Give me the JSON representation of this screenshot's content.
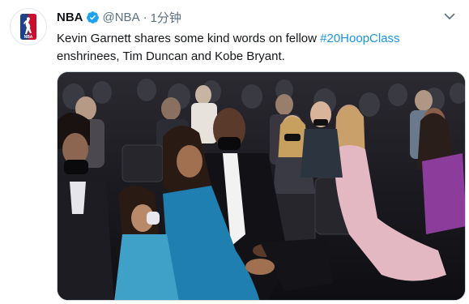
{
  "tweet": {
    "display_name": "NBA",
    "handle": "@NBA",
    "separator": "·",
    "time": "1分钟",
    "text_part1": "Kevin Garnett shares some kind words on fellow ",
    "hashtag": "#20HoopClass",
    "text_part2": " enshrinees, Tim Duncan and Kobe Bryant.",
    "media_description": "Video still of an audience seated in an arena, including Kevin Garnett and family"
  },
  "icons": {
    "avatar": "nba-logo-icon",
    "verified": "verified-badge-icon",
    "more": "chevron-down-icon"
  },
  "colors": {
    "hashtag": "#1b95e0",
    "verified": "#1da1f2",
    "text": "#14171a",
    "muted": "#5b7083"
  }
}
